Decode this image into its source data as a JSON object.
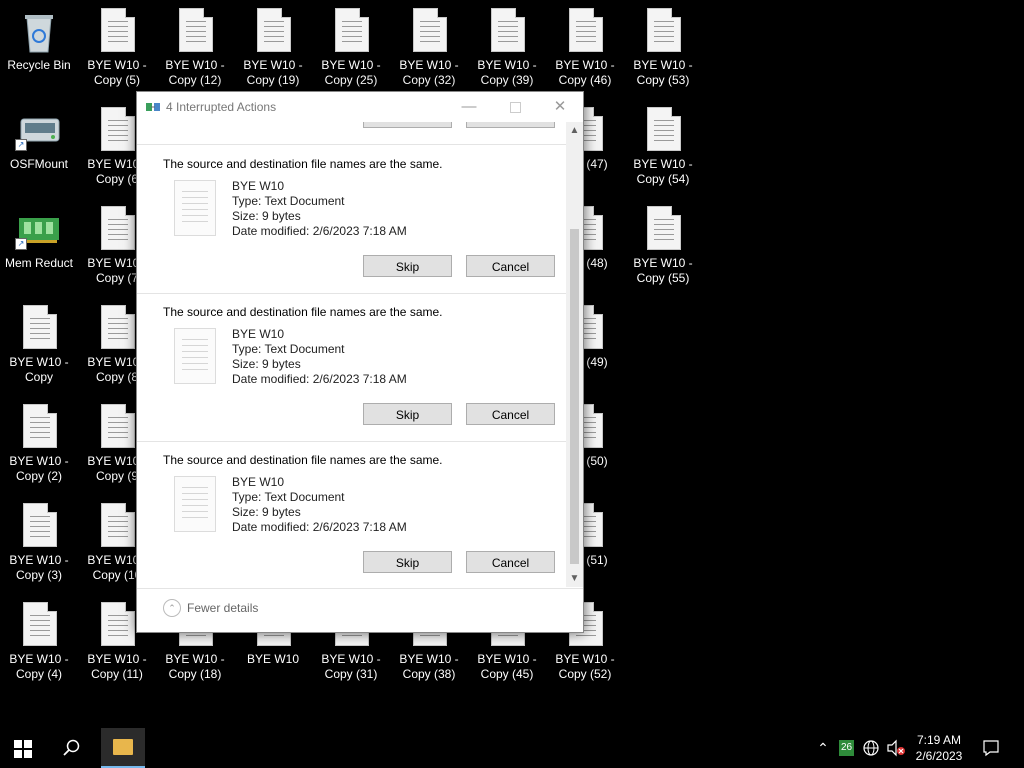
{
  "desktop": {
    "icons": [
      {
        "label": "Recycle Bin",
        "type": "recycle"
      },
      {
        "label": "OSFMount",
        "type": "osf"
      },
      {
        "label": "Mem Reduct",
        "type": "mem"
      },
      {
        "label": "BYE W10 - Copy",
        "type": "file"
      },
      {
        "label": "BYE W10 - Copy (2)",
        "type": "file"
      },
      {
        "label": "BYE W10 - Copy (3)",
        "type": "file"
      },
      {
        "label": "BYE W10 - Copy (4)",
        "type": "file"
      },
      {
        "label": "BYE W10 - Copy (5)",
        "type": "file"
      },
      {
        "label": "BYE W10 - Copy (6",
        "type": "file"
      },
      {
        "label": "BYE W10 - Copy (7",
        "type": "file"
      },
      {
        "label": "BYE W10 - Copy (8",
        "type": "file"
      },
      {
        "label": "BYE W10 - Copy (9",
        "type": "file"
      },
      {
        "label": "BYE W10 - Copy (10",
        "type": "file"
      },
      {
        "label": "BYE W10 - Copy (11)",
        "type": "file"
      },
      {
        "label": "BYE W10 - Copy (12)",
        "type": "file"
      },
      {
        "label": "BYE W10 - Copy (18)",
        "type": "file"
      },
      {
        "label": "BYE W10 - Copy (19)",
        "type": "file"
      },
      {
        "label": "BYE W10",
        "type": "file"
      },
      {
        "label": "BYE W10 - Copy (25)",
        "type": "file"
      },
      {
        "label": "BYE W10 - Copy (31)",
        "type": "file"
      },
      {
        "label": "BYE W10 - Copy (32)",
        "type": "file"
      },
      {
        "label": "BYE W10 - Copy (38)",
        "type": "file"
      },
      {
        "label": "BYE W10 - Copy (39)",
        "type": "file"
      },
      {
        "label": "BYE W10 - Copy (45)",
        "type": "file"
      },
      {
        "label": "BYE W10 - Copy (46)",
        "type": "file"
      },
      {
        "label": "10 - (47)",
        "type": "file"
      },
      {
        "label": "10 - (48)",
        "type": "file"
      },
      {
        "label": "10 - (49)",
        "type": "file"
      },
      {
        "label": "10 - (50)",
        "type": "file"
      },
      {
        "label": "10 - (51)",
        "type": "file"
      },
      {
        "label": "BYE W10 - Copy (52)",
        "type": "file"
      },
      {
        "label": "BYE W10 - Copy (53)",
        "type": "file"
      },
      {
        "label": "BYE W10 - Copy (54)",
        "type": "file"
      },
      {
        "label": "BYE W10 - Copy (55)",
        "type": "file"
      }
    ]
  },
  "dialog": {
    "title": "4 Interrupted Actions",
    "items": [
      {
        "message": "The source and destination file names are the same.",
        "name": "BYE W10",
        "type": "Type: Text Document",
        "size": "Size: 9 bytes",
        "modified": "Date modified: 2/6/2023 7:18 AM",
        "skip": "Skip",
        "cancel": "Cancel"
      },
      {
        "message": "The source and destination file names are the same.",
        "name": "BYE W10",
        "type": "Type: Text Document",
        "size": "Size: 9 bytes",
        "modified": "Date modified: 2/6/2023 7:18 AM",
        "skip": "Skip",
        "cancel": "Cancel"
      },
      {
        "message": "The source and destination file names are the same.",
        "name": "BYE W10",
        "type": "Type: Text Document",
        "size": "Size: 9 bytes",
        "modified": "Date modified: 2/6/2023 7:18 AM",
        "skip": "Skip",
        "cancel": "Cancel"
      }
    ],
    "footer": "Fewer details"
  },
  "taskbar": {
    "tray_badge": "26",
    "time": "7:19 AM",
    "date": "2/6/2023"
  }
}
